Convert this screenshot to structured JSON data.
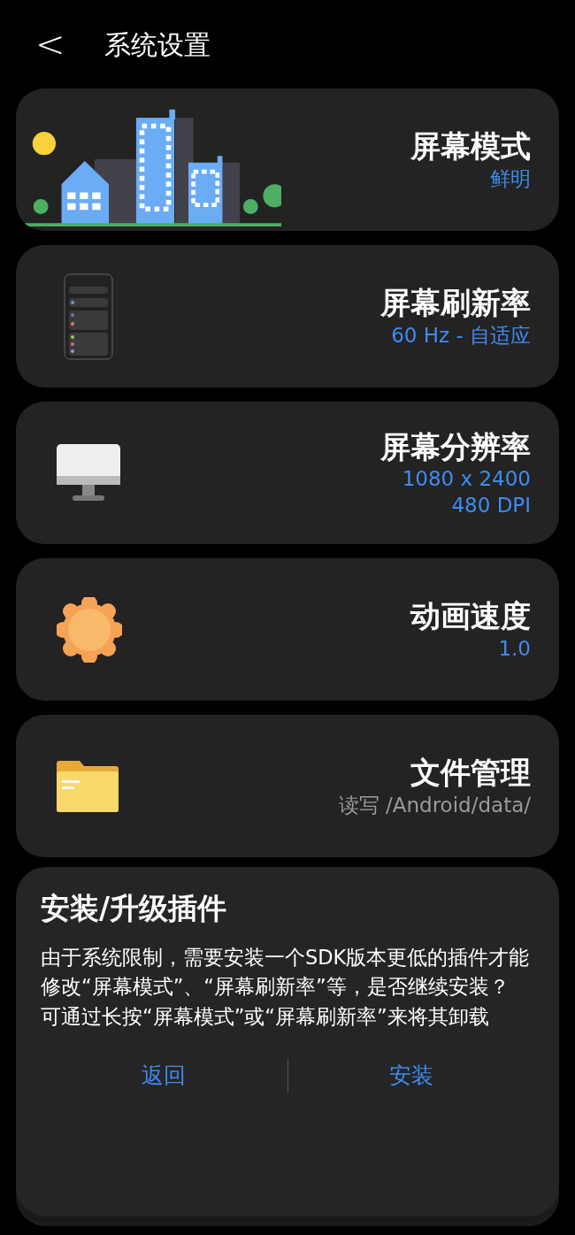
{
  "header": {
    "back": "<",
    "title": "系统设置"
  },
  "cards": [
    {
      "kind": "city",
      "title": "屏幕模式",
      "lines": [
        "鲜明"
      ],
      "accent": true
    },
    {
      "kind": "phone",
      "title": "屏幕刷新率",
      "lines": [
        "60 Hz - 自适应"
      ],
      "accent": true
    },
    {
      "kind": "monitor",
      "title": "屏幕分辨率",
      "lines": [
        "1080 x 2400",
        "480 DPI"
      ],
      "accent": true
    },
    {
      "kind": "sun",
      "title": "动画速度",
      "lines": [
        "1.0"
      ],
      "accent": true
    },
    {
      "kind": "folder",
      "title": "文件管理",
      "lines": [
        "读写 /Android/data/"
      ],
      "accent": false
    }
  ],
  "dialog": {
    "title": "安装/升级插件",
    "paragraphs": [
      "由于系统限制，需要安装一个SDK版本更低的插件才能修改“屏幕模式”、“屏幕刷新率”等，是否继续安装？",
      "可通过长按“屏幕模式”或“屏幕刷新率”来将其卸载"
    ],
    "buttons": [
      {
        "label": "返回"
      },
      {
        "label": "安装"
      }
    ]
  }
}
